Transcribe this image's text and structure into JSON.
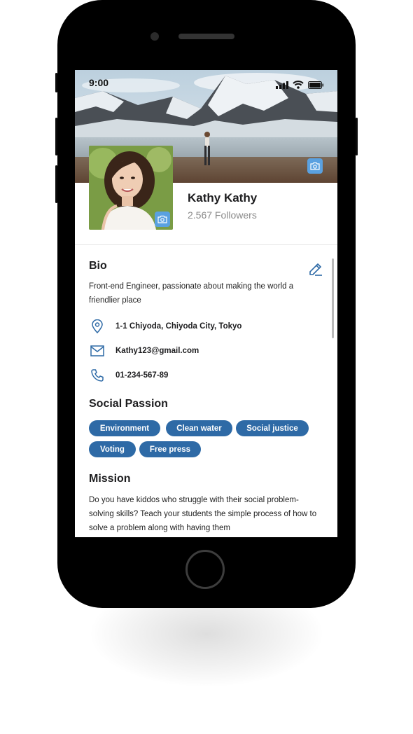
{
  "status_bar": {
    "time": "9:00"
  },
  "profile": {
    "name": "Kathy Kathy",
    "followers": "2.567 Followers"
  },
  "bio": {
    "title": "Bio",
    "text": "Front-end Engineer, passionate about making the world a friendlier place",
    "address": "1-1 Chiyoda, Chiyoda City, Tokyo",
    "email": "Kathy123@gmail.com",
    "phone": "01-234-567-89"
  },
  "social_passion": {
    "title": "Social Passion",
    "tags": [
      "Environment",
      "Clean water",
      "Social justice",
      "Voting",
      "Free press"
    ]
  },
  "mission": {
    "title": "Mission",
    "text": "Do you have kiddos who struggle with their social problem-solving skills? Teach your students the simple process of how to solve a problem along with having them"
  },
  "colors": {
    "accent": "#2e6aa6",
    "camera_badge": "#5aa1e0",
    "icon": "#2e6aa6"
  }
}
